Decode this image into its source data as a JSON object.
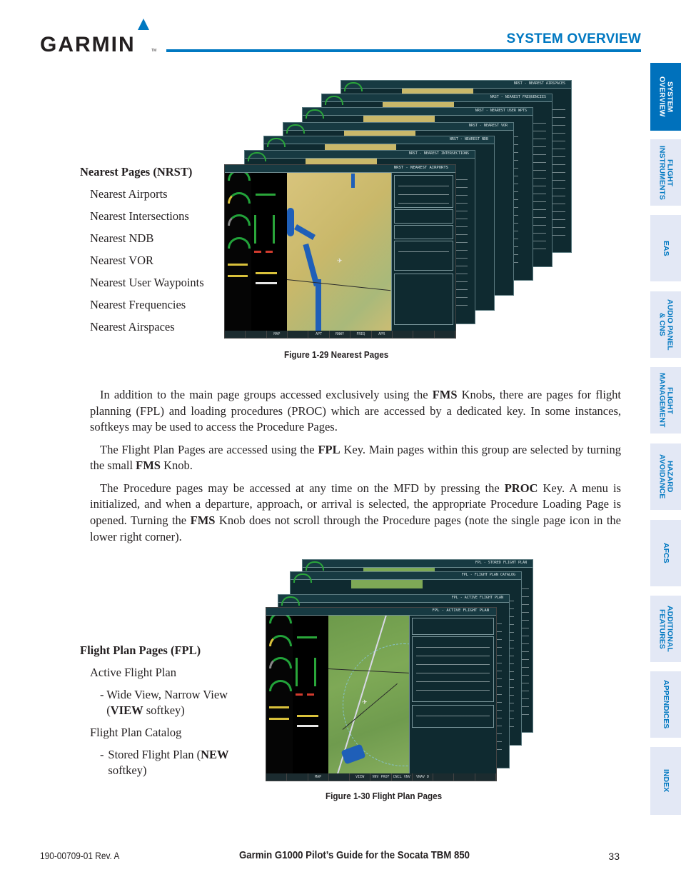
{
  "header": {
    "logo_text": "GARMIN",
    "logo_tm": "TM",
    "section_title": "SYSTEM OVERVIEW",
    "brand_color": "#0078c1"
  },
  "side_tabs": [
    {
      "label": "SYSTEM\nOVERVIEW",
      "active": true
    },
    {
      "label": "FLIGHT\nINSTRUMENTS",
      "active": false
    },
    {
      "label": "EAS",
      "active": false
    },
    {
      "label": "AUDIO PANEL\n& CNS",
      "active": false
    },
    {
      "label": "FLIGHT\nMANAGEMENT",
      "active": false
    },
    {
      "label": "HAZARD\nAVOIDANCE",
      "active": false
    },
    {
      "label": "AFCS",
      "active": false
    },
    {
      "label": "ADDITIONAL\nFEATURES",
      "active": false
    },
    {
      "label": "APPENDICES",
      "active": false
    },
    {
      "label": "INDEX",
      "active": false
    }
  ],
  "nearest": {
    "heading": "Nearest Pages (NRST)",
    "items": [
      "Nearest Airports",
      "Nearest Intersections",
      "Nearest NDB",
      "Nearest VOR",
      "Nearest User Waypoints",
      "Nearest Frequencies",
      "Nearest Airspaces"
    ],
    "figure_caption": "Figure 1-29  Nearest Pages",
    "screen_titles": [
      "NRST - NEAREST AIRSPACES",
      "NRST - NEAREST FREQUENCIES",
      "NRST - NEAREST USER WPTS",
      "NRST - NEAREST VOR",
      "NRST - NEAREST NDB",
      "NRST - NEAREST INTERSECTIONS",
      "NRST - NEAREST AIRPORTS"
    ],
    "front_softkeys": [
      "",
      "",
      "MAP",
      "",
      "APT",
      "RNWY",
      "FREQ",
      "APR",
      "",
      "",
      ""
    ]
  },
  "body": {
    "p1_a": "In addition to the main page groups accessed exclusively using the ",
    "p1_b": "FMS",
    "p1_c": " Knobs, there are pages for flight planning (FPL) and loading procedures (PROC) which are accessed by a dedicated key.  In some instances, softkeys may be used to access the Procedure Pages.",
    "p2_a": "The Flight Plan Pages are accessed using the ",
    "p2_b": "FPL",
    "p2_c": " Key.  Main pages within this group are selected by turning the small ",
    "p2_d": "FMS",
    "p2_e": " Knob.",
    "p3_a": "The Procedure pages may be accessed at any time on the MFD by pressing the ",
    "p3_b": "PROC",
    "p3_c": " Key.  A menu is initialized, and when a departure, approach, or arrival is selected, the appropriate Procedure Loading Page is opened.  Turning the ",
    "p3_d": "FMS",
    "p3_e": " Knob does not scroll through the Procedure pages (note the single page icon in the lower right corner)."
  },
  "fpl": {
    "heading": "Flight Plan Pages (FPL)",
    "item1": "Active Flight Plan",
    "sub1_a": "Wide View, Narrow View (",
    "sub1_b": "VIEW",
    "sub1_c": " softkey)",
    "item2": "Flight Plan Catalog",
    "sub2_a": "Stored Flight Plan (",
    "sub2_b": "NEW",
    "sub2_c": " softkey)",
    "dash": "-",
    "figure_caption": "Figure 1-30  Flight Plan Pages",
    "screen_titles": [
      "FPL - STORED FLIGHT PLAN",
      "FPL - FLIGHT PLAN CATALOG",
      "FPL - ACTIVE FLIGHT PLAN",
      "FPL - ACTIVE FLIGHT PLAN"
    ],
    "front_softkeys": [
      "",
      "",
      "MAP",
      "",
      "VIEW",
      "VNV PROF",
      "CNCL VNV",
      "VNAV D",
      "",
      "",
      ""
    ]
  },
  "footer": {
    "doc_number": "190-00709-01  Rev. A",
    "title": "Garmin G1000 Pilot’s Guide for the Socata TBM 850",
    "page_number": "33"
  }
}
